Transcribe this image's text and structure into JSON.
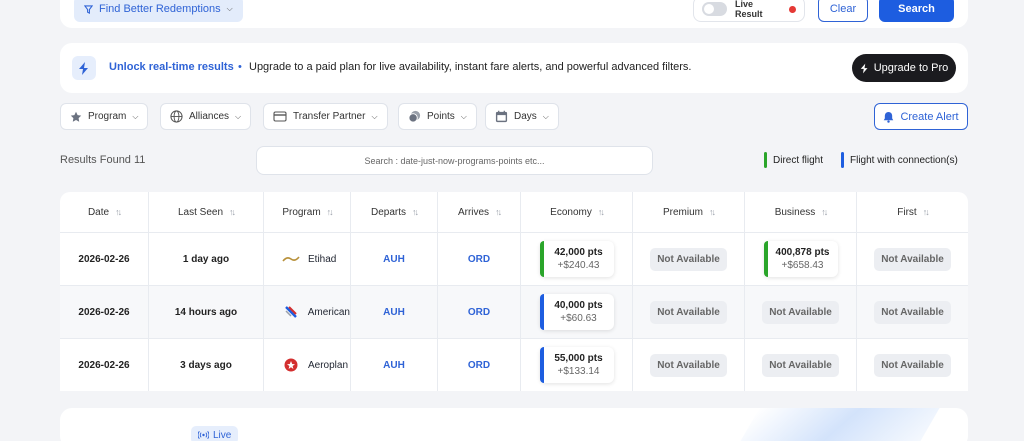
{
  "topbar": {
    "find_label": "Find Better Redemptions",
    "live_result_label": "Live Result",
    "clear_label": "Clear",
    "search_label": "Search"
  },
  "banner": {
    "title": "Unlock real-time results",
    "separator": "•",
    "text": "Upgrade to a paid plan for live availability, instant fare alerts, and powerful advanced filters.",
    "upgrade_label": "Upgrade to Pro"
  },
  "filters": [
    {
      "label": "Program",
      "icon": "star-icon"
    },
    {
      "label": "Alliances",
      "icon": "globe-icon"
    },
    {
      "label": "Transfer Partner",
      "icon": "card-icon"
    },
    {
      "label": "Points",
      "icon": "coins-icon"
    },
    {
      "label": "Days",
      "icon": "calendar-icon"
    }
  ],
  "create_alert_label": "Create Alert",
  "results": {
    "found_label": "Results Found 11",
    "search_placeholder": "Search : date-just-now-programs-points etc..."
  },
  "legend": {
    "direct_label": "Direct flight",
    "direct_color": "#2aa52a",
    "connection_label": "Flight with connection(s)",
    "connection_color": "#1d5de0"
  },
  "table": {
    "headers": [
      "Date",
      "Last Seen",
      "Program",
      "Departs",
      "Arrives",
      "Economy",
      "Premium",
      "Business",
      "First"
    ],
    "rows": [
      {
        "date": "2026-02-26",
        "last_seen": "1 day ago",
        "program": "Etihad",
        "departs": "AUH",
        "arrives": "ORD",
        "economy_pts": "42,000 pts",
        "economy_cash": "+$240.43",
        "economy_type": "direct",
        "premium": "Not Available",
        "business_pts": "400,878 pts",
        "business_cash": "+$658.43",
        "business_type": "direct",
        "first": "Not Available"
      },
      {
        "date": "2026-02-26",
        "last_seen": "14 hours ago",
        "program": "American",
        "departs": "AUH",
        "arrives": "ORD",
        "economy_pts": "40,000 pts",
        "economy_cash": "+$60.63",
        "economy_type": "connection",
        "premium": "Not Available",
        "business": "Not Available",
        "first": "Not Available"
      },
      {
        "date": "2026-02-26",
        "last_seen": "3 days ago",
        "program": "Aeroplan",
        "departs": "AUH",
        "arrives": "ORD",
        "economy_pts": "55,000 pts",
        "economy_cash": "+$133.14",
        "economy_type": "connection",
        "premium": "Not Available",
        "business": "Not Available",
        "first": "Not Available"
      }
    ]
  },
  "bottom": {
    "live_label": "Live"
  }
}
